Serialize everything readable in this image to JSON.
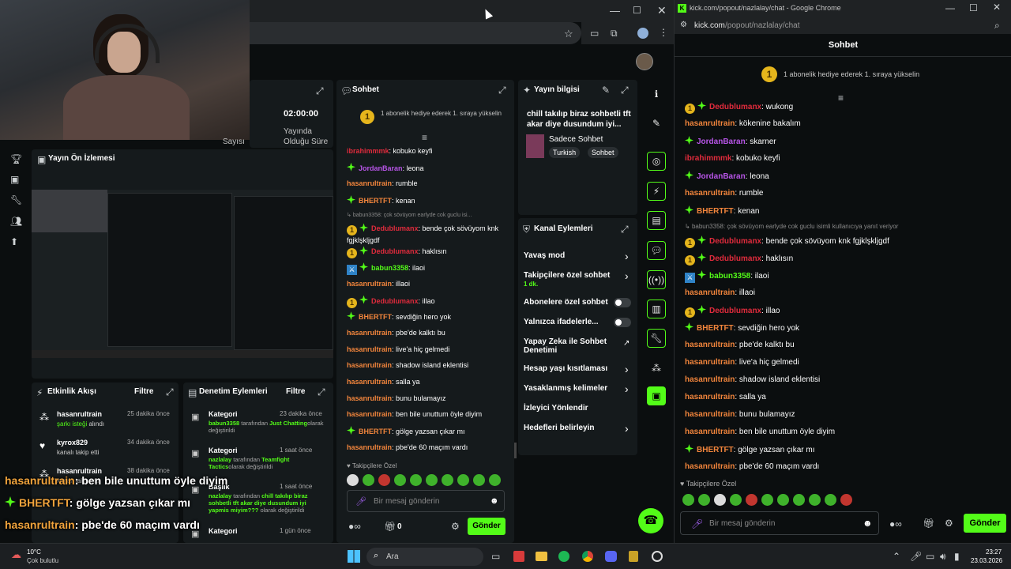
{
  "browser_mid": {
    "new_tab": "+"
  },
  "webcam": {
    "label": ""
  },
  "left_nav": {
    "icons": [
      "trophy-icon",
      "video-icon",
      "wrench-icon",
      "users-icon",
      "upload-icon"
    ]
  },
  "stats": {
    "time": "02:00:00",
    "time_caption_1": "Yayında",
    "time_caption_2": "Olduğu Süre",
    "left_caption": "Sayısı"
  },
  "preview": {
    "title": "Yayın Ön İzlemesi"
  },
  "activity": {
    "title": "Etkinlik Akışı",
    "filter": "Filtre",
    "items": [
      {
        "user": "hasanrultrain",
        "detail": "şarkı isteği",
        "detail_rest": " alındı",
        "time": "25 dakika önce"
      },
      {
        "user": "kyrox829",
        "detail": "kanalı takip etti",
        "detail_rest": "",
        "time": "34 dakika önce"
      },
      {
        "user": "hasanrultrain",
        "detail": "kanalı takip etti",
        "detail_rest": "",
        "time": "38 dakika önce"
      }
    ]
  },
  "moderation": {
    "title": "Denetim Eylemleri",
    "filter": "Filtre",
    "items": [
      {
        "title": "Kategori",
        "time": "23 dakika önce",
        "actor": "babun3358",
        "mid": " tarafından ",
        "target": "Just Chatting",
        "tail": "olarak değiştirildi"
      },
      {
        "title": "Kategori",
        "time": "1 saat önce",
        "actor": "nazlalay",
        "mid": " tarafından ",
        "target": "Teamfight Tactics",
        "tail": "olarak değiştirildi"
      },
      {
        "title": "Başlık",
        "time": "1 saat önce",
        "actor": "nazlalay",
        "mid": " tarafından ",
        "target": "chill takılıp biraz sohbetli tft akar diye dusundum iyi yapmis miyim???",
        "tail": " olarak değiştirildi"
      },
      {
        "title": "Kategori",
        "time": "1 gün önce",
        "actor": "",
        "mid": "",
        "target": "",
        "tail": ""
      }
    ]
  },
  "overlay_chat": [
    {
      "user": "hasanrultrain",
      "text": ": ben bile unuttum öyle diyim"
    },
    {
      "user": "BHERTFT",
      "text": ": gölge yazsan çıkar mı"
    },
    {
      "user": "hasanrultrain",
      "text": ": pbe'de 60 maçım vardı"
    }
  ],
  "mid_chat": {
    "title": "Sohbet",
    "pinned": "1 abonelik hediye ederek 1. sıraya yükselin",
    "reply_ctx": "babun3358: çok sövüyom earlyde cok guclu isi...",
    "messages": [
      {
        "user": "ibrahimmmk",
        "cls": "c-r",
        "badge": "",
        "text": ": kobuko keyfi"
      },
      {
        "user": "JordanBaran",
        "cls": "c-p",
        "badge": "gem",
        "text": ": leona"
      },
      {
        "user": "hasanrultrain",
        "cls": "c-o",
        "badge": "",
        "text": ": rumble"
      },
      {
        "user": "BHERTFT",
        "cls": "c-o",
        "badge": "gem",
        "text": ": kenan"
      },
      {
        "user": "Dedublumanx",
        "cls": "c-r",
        "badge": "coin",
        "text": ": bende çok sövüyom knk fgjklşkljgdf",
        "reply": true
      },
      {
        "user": "Dedublumanx",
        "cls": "c-r",
        "badge": "coin",
        "text": ": haklısın"
      },
      {
        "user": "babun3358",
        "cls": "c-g",
        "badge": "sword",
        "text": ": ilaoi"
      },
      {
        "user": "hasanrultrain",
        "cls": "c-o",
        "badge": "",
        "text": ": illaoi"
      },
      {
        "user": "Dedublumanx",
        "cls": "c-r",
        "badge": "coin",
        "text": ": illao"
      },
      {
        "user": "BHERTFT",
        "cls": "c-o",
        "badge": "gem",
        "text": ": sevdiğin hero yok"
      },
      {
        "user": "hasanrultrain",
        "cls": "c-o",
        "badge": "",
        "text": ": pbe'de kalktı bu"
      },
      {
        "user": "hasanrultrain",
        "cls": "c-o",
        "badge": "",
        "text": ": live'a hiç gelmedi"
      },
      {
        "user": "hasanrultrain",
        "cls": "c-o",
        "badge": "",
        "text": ": shadow island eklentisi"
      },
      {
        "user": "hasanrultrain",
        "cls": "c-o",
        "badge": "",
        "text": ": salla ya"
      },
      {
        "user": "hasanrultrain",
        "cls": "c-o",
        "badge": "",
        "text": ": bunu bulamayız"
      },
      {
        "user": "hasanrultrain",
        "cls": "c-o",
        "badge": "",
        "text": ": ben bile unuttum öyle diyim"
      },
      {
        "user": "BHERTFT",
        "cls": "c-o",
        "badge": "gem",
        "text": ": gölge yazsan çıkar mı"
      },
      {
        "user": "hasanrultrain",
        "cls": "c-o",
        "badge": "",
        "text": ": pbe'de 60 maçım vardı"
      }
    ],
    "followers_only": "Takipçilere Özel",
    "input_placeholder": "Bir mesaj gönderin",
    "count": "0",
    "send": "Gönder"
  },
  "stream_info": {
    "title": "Yayın bilgisi",
    "stream_title": "chill takılıp biraz sohbetli tft akar diye dusundum iyi...",
    "category": "Sadece Sohbet",
    "tags": [
      "Turkish",
      "Sohbet"
    ]
  },
  "channel_actions": {
    "title": "Kanal Eylemleri",
    "items": [
      {
        "label": "Yavaş mod",
        "sub": "",
        "ctrl": "chevron"
      },
      {
        "label": "Takipçilere özel sohbet",
        "sub": "1 dk.",
        "ctrl": "chevron"
      },
      {
        "label": "Abonelere özel sohbet",
        "sub": "",
        "ctrl": "toggle"
      },
      {
        "label": "Yalnızca ifadelerle...",
        "sub": "",
        "ctrl": "toggle"
      },
      {
        "label": "Yapay Zeka ile Sohbet Denetimi",
        "sub": "",
        "ctrl": "external"
      },
      {
        "label": "Hesap yaşı kısıtlaması",
        "sub": "",
        "ctrl": "chevron"
      },
      {
        "label": "Yasaklanmış kelimeler",
        "sub": "",
        "ctrl": "chevron"
      },
      {
        "label": "İzleyici Yönlendir",
        "sub": "",
        "ctrl": "none"
      },
      {
        "label": "Hedefleri belirleyin",
        "sub": "",
        "ctrl": "chevron"
      }
    ]
  },
  "popout": {
    "window_title": "kick.com/popout/nazlalay/chat - Google Chrome",
    "url_host": "kick.com",
    "url_path": "/popout/nazlalay/chat",
    "title": "Sohbet",
    "pinned": "1 abonelik hediye ederek 1. sıraya yükselin",
    "reply_ctx": "babun3358: çok sövüyom earlyde cok guclu isimli kullanıcıya yanıt veriyor",
    "messages": [
      {
        "user": "Dedublumanx",
        "cls": "c-r",
        "badge": "coingem",
        "text": ": wukong"
      },
      {
        "user": "hasanrultrain",
        "cls": "c-o",
        "badge": "",
        "text": ": kökenine bakalım"
      },
      {
        "user": "JordanBaran",
        "cls": "c-p",
        "badge": "gem",
        "text": ": skarner"
      },
      {
        "user": "ibrahimmmk",
        "cls": "c-r",
        "badge": "",
        "text": ": kobuko keyfi"
      },
      {
        "user": "JordanBaran",
        "cls": "c-p",
        "badge": "gem",
        "text": ": leona"
      },
      {
        "user": "hasanrultrain",
        "cls": "c-o",
        "badge": "",
        "text": ": rumble"
      },
      {
        "user": "BHERTFT",
        "cls": "c-o",
        "badge": "gem",
        "text": ": kenan"
      },
      {
        "user": "Dedublumanx",
        "cls": "c-r",
        "badge": "coingem",
        "text": ": bende çok sövüyom knk fgjklşkljgdf",
        "reply": true
      },
      {
        "user": "Dedublumanx",
        "cls": "c-r",
        "badge": "coingem",
        "text": ": haklısın"
      },
      {
        "user": "babun3358",
        "cls": "c-g",
        "badge": "sword",
        "text": ": ilaoi"
      },
      {
        "user": "hasanrultrain",
        "cls": "c-o",
        "badge": "",
        "text": ": illaoi"
      },
      {
        "user": "Dedublumanx",
        "cls": "c-r",
        "badge": "coingem",
        "text": ": illao"
      },
      {
        "user": "BHERTFT",
        "cls": "c-o",
        "badge": "gem",
        "text": ": sevdiğin hero yok"
      },
      {
        "user": "hasanrultrain",
        "cls": "c-o",
        "badge": "",
        "text": ": pbe'de kalktı bu"
      },
      {
        "user": "hasanrultrain",
        "cls": "c-o",
        "badge": "",
        "text": ": live'a hiç gelmedi"
      },
      {
        "user": "hasanrultrain",
        "cls": "c-o",
        "badge": "",
        "text": ": shadow island eklentisi"
      },
      {
        "user": "hasanrultrain",
        "cls": "c-o",
        "badge": "",
        "text": ": salla ya"
      },
      {
        "user": "hasanrultrain",
        "cls": "c-o",
        "badge": "",
        "text": ": bunu bulamayız"
      },
      {
        "user": "hasanrultrain",
        "cls": "c-o",
        "badge": "",
        "text": ": ben bile unuttum öyle diyim"
      },
      {
        "user": "BHERTFT",
        "cls": "c-o",
        "badge": "gem",
        "text": ": gölge yazsan çıkar mı"
      },
      {
        "user": "hasanrultrain",
        "cls": "c-o",
        "badge": "",
        "text": ": pbe'de 60 maçım vardı"
      }
    ],
    "followers_only": "Takipçilere Özel",
    "input_placeholder": "Bir mesaj gönderin",
    "send": "Gönder"
  },
  "taskbar": {
    "temp": "10°C",
    "weather": "Çok bulutlu",
    "search": "Ara",
    "time": "23:27",
    "date": "23.03.2026"
  },
  "colors": {
    "accent": "#53fc18",
    "bg": "#0b0e0f",
    "panel": "#151a1c"
  }
}
